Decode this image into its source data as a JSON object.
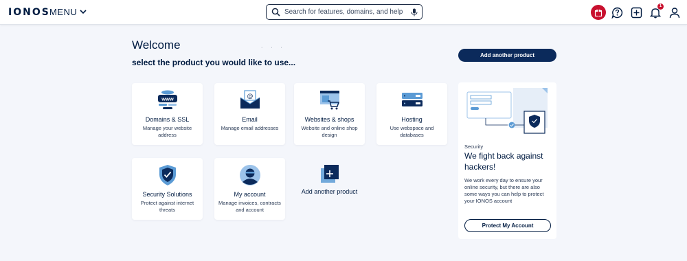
{
  "header": {
    "logo_text": "IONOS",
    "menu_label": "MENU",
    "search": {
      "placeholder": "Search for features, domains, and help"
    },
    "notification_count": "1"
  },
  "main": {
    "welcome": "Welcome",
    "subtitle": "select the product you would like to use...",
    "products": [
      {
        "title": "Domains & SSL",
        "desc": "Manage your website address",
        "icon": "www-domain-icon"
      },
      {
        "title": "Email",
        "desc": "Manage email addresses",
        "icon": "envelope-icon"
      },
      {
        "title": "Websites & shops",
        "desc": "Website and online shop design",
        "icon": "website-cart-icon"
      },
      {
        "title": "Hosting",
        "desc": "Use webspace and databases",
        "icon": "server-icon"
      },
      {
        "title": "Security Solutions",
        "desc": "Protect against internet threats",
        "icon": "shield-check-icon"
      },
      {
        "title": "My account",
        "desc": "Manage invoices, contracts and account",
        "icon": "user-avatar-icon"
      }
    ],
    "add_product_card": {
      "title": "Add another product",
      "icon": "plus-square-icon"
    }
  },
  "sidebar": {
    "add_button": "Add another product",
    "security_panel": {
      "category": "Security",
      "title": "We fight back against hackers!",
      "text": "We work every day to ensure your online security, but there are also some ways you can help to protect your IONOS account",
      "button": "Protect My Account"
    }
  },
  "colors": {
    "brand_navy": "#0b2a5b",
    "text_dark": "#001b41",
    "accent_blue": "#5b9bd5",
    "alert_red": "#c8102e",
    "background": "#f4f6fb"
  }
}
